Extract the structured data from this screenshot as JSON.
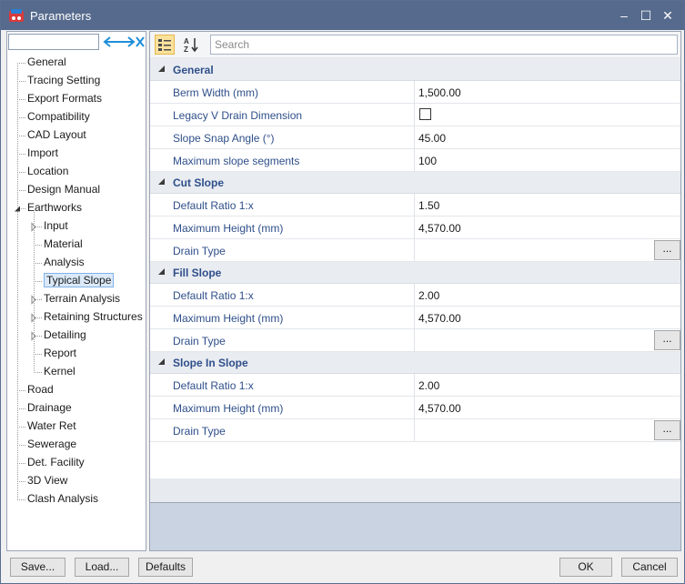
{
  "window": {
    "title": "Parameters",
    "minimize": "–",
    "maximize": "☐",
    "close": "✕"
  },
  "search": {
    "placeholder": "Search",
    "value": ""
  },
  "tree": [
    {
      "label": "General",
      "level": 0
    },
    {
      "label": "Tracing Setting",
      "level": 0
    },
    {
      "label": "Export Formats",
      "level": 0
    },
    {
      "label": "Compatibility",
      "level": 0
    },
    {
      "label": "CAD Layout",
      "level": 0
    },
    {
      "label": "Import",
      "level": 0
    },
    {
      "label": "Location",
      "level": 0
    },
    {
      "label": "Design Manual",
      "level": 0
    },
    {
      "label": "Earthworks",
      "level": 0,
      "expanded": true
    },
    {
      "label": "Input",
      "level": 1,
      "expander": true
    },
    {
      "label": "Material",
      "level": 1
    },
    {
      "label": "Analysis",
      "level": 1
    },
    {
      "label": "Typical Slope",
      "level": 1,
      "selected": true
    },
    {
      "label": "Terrain Analysis",
      "level": 1,
      "expander": true
    },
    {
      "label": "Retaining Structures",
      "level": 1,
      "expander": true
    },
    {
      "label": "Detailing",
      "level": 1,
      "expander": true
    },
    {
      "label": "Report",
      "level": 1
    },
    {
      "label": "Kernel",
      "level": 1
    },
    {
      "label": "Road",
      "level": 0
    },
    {
      "label": "Drainage",
      "level": 0
    },
    {
      "label": "Water Ret",
      "level": 0
    },
    {
      "label": "Sewerage",
      "level": 0
    },
    {
      "label": "Det. Facility",
      "level": 0
    },
    {
      "label": "3D View",
      "level": 0
    },
    {
      "label": "Clash Analysis",
      "level": 0
    }
  ],
  "categories": [
    {
      "name": "General",
      "props": [
        {
          "name": "Berm Width (mm)",
          "value": "1,500.00"
        },
        {
          "name": "Legacy V Drain Dimension",
          "type": "checkbox",
          "checked": false
        },
        {
          "name": "Slope Snap Angle (°)",
          "value": "45.00"
        },
        {
          "name": "Maximum slope segments",
          "value": "100"
        }
      ]
    },
    {
      "name": "Cut Slope",
      "props": [
        {
          "name": "Default Ratio 1:x",
          "value": "1.50"
        },
        {
          "name": "Maximum Height (mm)",
          "value": "4,570.00"
        },
        {
          "name": "Drain Type",
          "value": "",
          "button": "..."
        }
      ]
    },
    {
      "name": "Fill Slope",
      "props": [
        {
          "name": "Default Ratio 1:x",
          "value": "2.00"
        },
        {
          "name": "Maximum Height (mm)",
          "value": "4,570.00"
        },
        {
          "name": "Drain Type",
          "value": "",
          "button": "..."
        }
      ]
    },
    {
      "name": "Slope In Slope",
      "props": [
        {
          "name": "Default Ratio 1:x",
          "value": "2.00"
        },
        {
          "name": "Maximum Height (mm)",
          "value": "4,570.00"
        },
        {
          "name": "Drain Type",
          "value": "",
          "button": "..."
        }
      ]
    }
  ],
  "footer": {
    "save": "Save...",
    "load": "Load...",
    "defaults": "Defaults",
    "ok": "OK",
    "cancel": "Cancel"
  },
  "colors": {
    "titlebar": "#556a8c",
    "category_text": "#2f4f8a",
    "selection": "#dbe9f8",
    "description_area": "#c9d3e2"
  }
}
